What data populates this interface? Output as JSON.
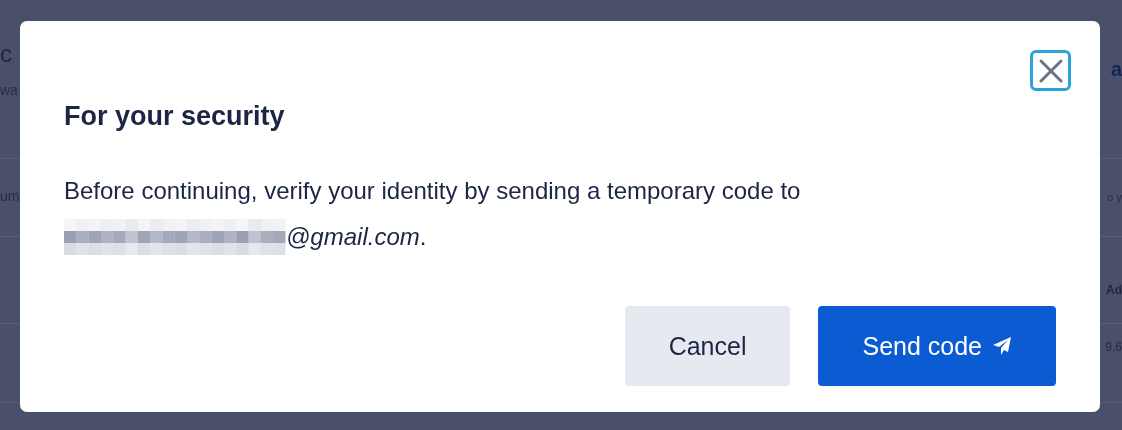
{
  "background": {
    "left_fragments": [
      {
        "text": "c",
        "kind": "heading"
      },
      {
        "text": "wa",
        "kind": "subtitle"
      },
      {
        "text": "um",
        "kind": "cell"
      }
    ],
    "right_fragments": [
      {
        "text": "a",
        "kind": "link"
      },
      {
        "text": "o y",
        "kind": "cell"
      },
      {
        "text": "Ad",
        "kind": "header"
      },
      {
        "text": "9.6",
        "kind": "cell"
      }
    ]
  },
  "dialog": {
    "title": "For your security",
    "message": "Before continuing, verify your identity by sending a temporary code to",
    "email_suffix": "*@gmail.com*.",
    "buttons": [
      {
        "label": "Cancel",
        "kind": "secondary"
      },
      {
        "label": "Send code",
        "kind": "primary"
      }
    ]
  }
}
